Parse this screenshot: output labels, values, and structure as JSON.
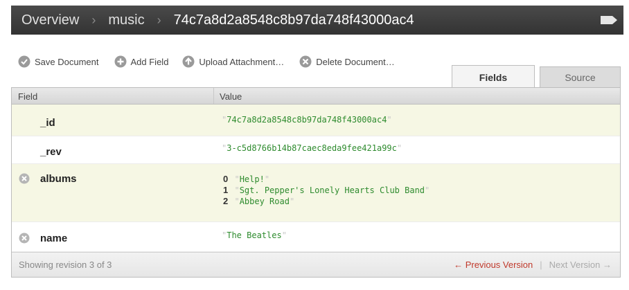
{
  "breadcrumb": {
    "items": [
      "Overview",
      "music",
      "74c7a8d2a8548c8b97da748f43000ac4"
    ]
  },
  "toolbar": {
    "save_label": "Save Document",
    "add_label": "Add Field",
    "upload_label": "Upload Attachment…",
    "delete_label": "Delete Document…"
  },
  "tabs": {
    "fields": "Fields",
    "source": "Source"
  },
  "table": {
    "headers": {
      "field": "Field",
      "value": "Value"
    },
    "rows": {
      "id": {
        "field": "_id",
        "value": "74c7a8d2a8548c8b97da748f43000ac4"
      },
      "rev": {
        "field": "_rev",
        "value": "3-c5d8766b14b87caec8eda9fee421a99c"
      },
      "albums": {
        "field": "albums",
        "items": [
          {
            "index": "0",
            "value": "Help!"
          },
          {
            "index": "1",
            "value": "Sgt. Pepper's Lonely Hearts Club Band"
          },
          {
            "index": "2",
            "value": "Abbey Road"
          }
        ]
      },
      "name": {
        "field": "name",
        "value": "The Beatles"
      }
    },
    "footer": {
      "status": "Showing revision 3 of 3",
      "prev": "← Previous Version",
      "separator": "|",
      "next": "Next Version →"
    }
  },
  "icons": {
    "save": "check-circle-icon",
    "add": "plus-circle-icon",
    "upload": "arrow-up-circle-icon",
    "delete": "x-circle-icon",
    "tag": "tag-icon"
  },
  "colors": {
    "topbar": "#3a3a3a",
    "value_text": "#2e8b2e",
    "prev_link": "#c0392b",
    "row_highlight": "#f6f7e4"
  }
}
